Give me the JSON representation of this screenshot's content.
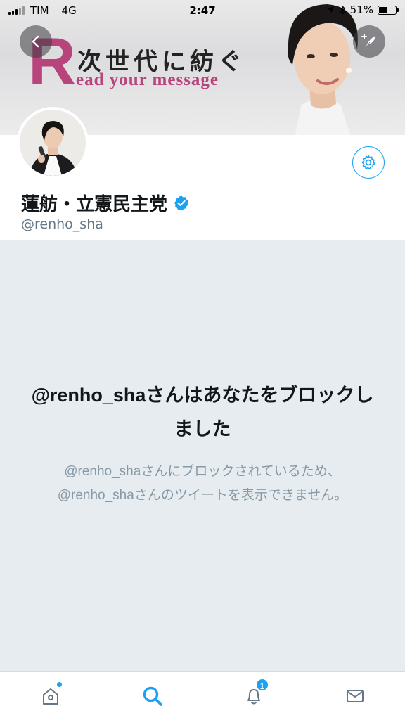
{
  "status_bar": {
    "carrier": "TIM",
    "network": "4G",
    "time": "2:47",
    "battery": "51%"
  },
  "banner": {
    "logo_letter": "R",
    "tagline_jp": "次世代に紡ぐ",
    "tagline_en": "ead your message",
    "brand_color": "#b8447c"
  },
  "profile": {
    "name": "蓮舫・立憲民主党",
    "handle": "@renho_sha",
    "verified": true
  },
  "blocked": {
    "title": "@renho_shaさんはあなたをブロックしました",
    "message": "@renho_shaさんにブロックされているため、@renho_shaさんのツイートを表示できません。"
  },
  "tabbar": {
    "tabs": [
      {
        "name": "home-icon",
        "active": false,
        "dot": true
      },
      {
        "name": "search-icon",
        "active": true
      },
      {
        "name": "notifications-icon",
        "active": false,
        "badge": "1"
      },
      {
        "name": "messages-icon",
        "active": false
      }
    ]
  },
  "colors": {
    "accent": "#1da1f2",
    "background": "#e6ecf0",
    "muted": "#8899a6"
  }
}
